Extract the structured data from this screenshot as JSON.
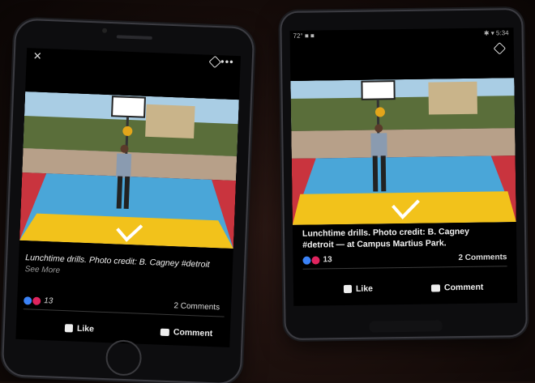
{
  "left_phone": {
    "caption": "Lunchtime drills. Photo credit: B. Cagney #detroit",
    "see_more": "See More",
    "reaction_count": "13",
    "comments": "2 Comments",
    "like_label": "Like",
    "comment_label": "Comment",
    "close_icon": "close-icon",
    "more_icon": "more-dots-icon",
    "tag_icon": "tag-icon"
  },
  "right_phone": {
    "status_left": "72° ■ ■",
    "status_right": "✱ ▾ 5:34",
    "caption_line1": "Lunchtime drills. Photo credit: B. Cagney",
    "caption_line2": "#detroit — at Campus Martius Park.",
    "reaction_count": "13",
    "comments": "2 Comments",
    "like_label": "Like",
    "comment_label": "Comment",
    "tag_icon": "tag-icon"
  },
  "colors": {
    "court_blue": "#4aa6d8",
    "court_yellow": "#f2c21b",
    "court_red": "#c9343e",
    "sky": "#a9cde4",
    "reaction_like": "#3b82f6",
    "reaction_love": "#e0245e"
  }
}
